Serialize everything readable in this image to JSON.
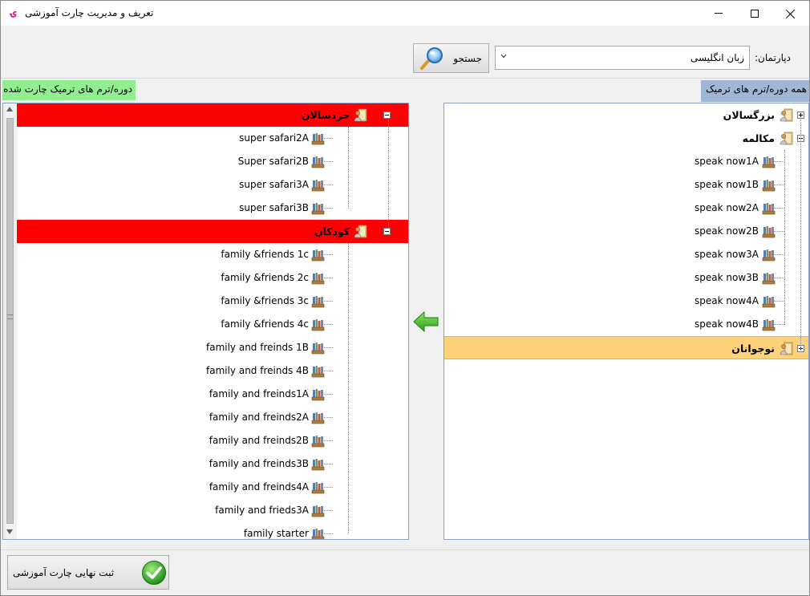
{
  "window": {
    "title": "تعریف و مدیریت چارت آموزشی",
    "app_icon": "ۍ"
  },
  "toolbar": {
    "department_label": "دپارتمان:",
    "department_value": "زبان انگلیسی",
    "search_label": "جستجو"
  },
  "left_panel": {
    "title": "دوره/ترم های ترمیک چارت شده",
    "groups": [
      {
        "label": "خردسالان",
        "highlight_color": "#ff0000",
        "items": [
          "super safari2A",
          "Super safari2B",
          "super safari3A",
          "super safari3B"
        ]
      },
      {
        "label": "کودکان",
        "highlight_color": "#ff0000",
        "items": [
          "family &friends 1c",
          "family &friends 2c",
          "family &friends 3c",
          "family &friends 4c",
          "family and freinds 1B",
          "family and freinds 4B",
          "family and freinds1A",
          "family and freinds2A",
          "family and freinds2B",
          "family and freinds3B",
          "family and freinds4A",
          "family and frieds3A",
          "family starter"
        ]
      }
    ]
  },
  "right_panel": {
    "title": "همه دوره/ترم های ترمیک",
    "groups": [
      {
        "label": "بزرگسالان",
        "expanded": false,
        "items": []
      },
      {
        "label": "مکالمه",
        "expanded": true,
        "items": [
          "speak now1A",
          "speak now1B",
          "speak now2A",
          "speak now2B",
          "speak now3A",
          "speak now3B",
          "speak now4A",
          "speak now4B"
        ]
      },
      {
        "label": "نوجوانان",
        "expanded": false,
        "selected": true,
        "highlight_color": "#fdd27a",
        "items": []
      }
    ]
  },
  "actions": {
    "submit_label": "ثبت نهایی چارت آموزشی"
  },
  "icons": {
    "group": "folder-person-icon",
    "item": "books-icon",
    "move": "green-left-arrow-icon",
    "search": "magnifier-icon",
    "submit": "green-check-icon"
  }
}
